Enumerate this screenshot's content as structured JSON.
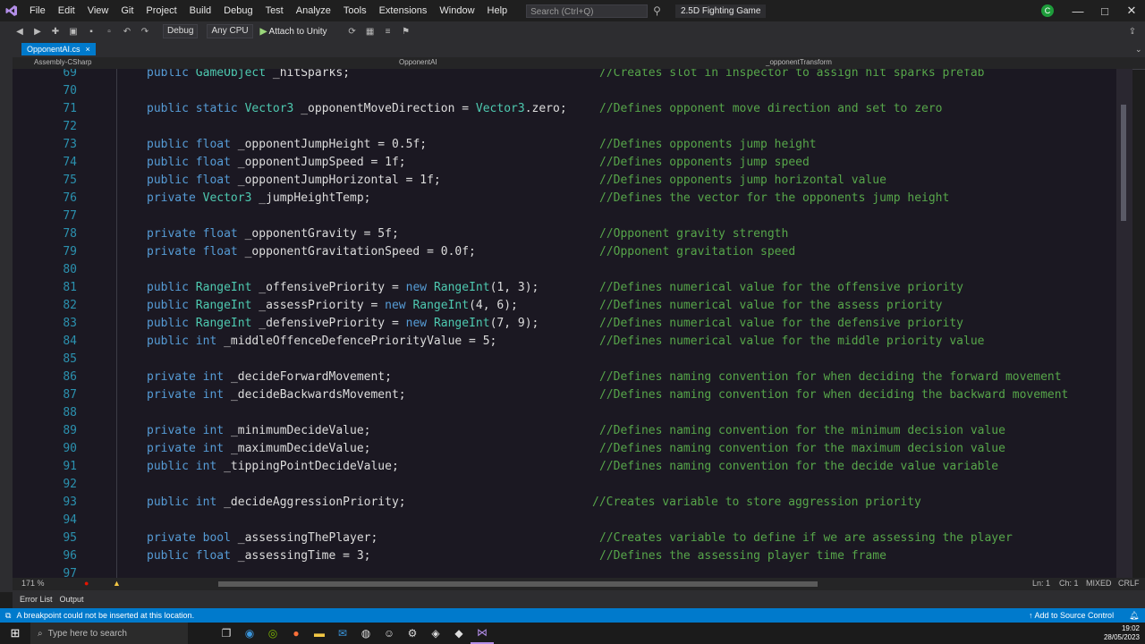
{
  "menubar": {
    "items": [
      "File",
      "Edit",
      "View",
      "Git",
      "Project",
      "Build",
      "Debug",
      "Test",
      "Analyze",
      "Tools",
      "Extensions",
      "Window",
      "Help"
    ],
    "search_placeholder": "Search (Ctrl+Q)",
    "solution_name": "2.5D Fighting Game",
    "avatar_initial": "C"
  },
  "toolbar": {
    "configuration": "Debug",
    "platform": "Any CPU",
    "run_label": "Attach to Unity"
  },
  "document_tab": {
    "filename": "OpponentAI.cs",
    "close": "×"
  },
  "navigation_bar": {
    "project": "Assembly-CSharp",
    "class": "OpponentAI",
    "member": "_opponentTransform"
  },
  "code_lines": [
    {
      "num": "69",
      "code": "public GameObject _hitSparks;",
      "comment": "//Creates slot in inspector to assign hit sparks prefab"
    },
    {
      "num": "70",
      "code": "",
      "comment": ""
    },
    {
      "num": "71",
      "code": "public static Vector3 _opponentMoveDirection = Vector3.zero;",
      "comment": "//Defines opponent move direction and set to zero"
    },
    {
      "num": "72",
      "code": "",
      "comment": ""
    },
    {
      "num": "73",
      "code": "public float _opponentJumpHeight = 0.5f;",
      "comment": "//Defines opponents jump height"
    },
    {
      "num": "74",
      "code": "public float _opponentJumpSpeed = 1f;",
      "comment": "//Defines opponents jump speed"
    },
    {
      "num": "75",
      "code": "public float _opponentJumpHorizontal = 1f;",
      "comment": "//Defines opponents jump horizontal value"
    },
    {
      "num": "76",
      "code": "private Vector3 _jumpHeightTemp;",
      "comment": "//Defines the vector for the opponents jump height"
    },
    {
      "num": "77",
      "code": "",
      "comment": ""
    },
    {
      "num": "78",
      "code": "private float _opponentGravity = 5f;",
      "comment": "//Opponent gravity strength"
    },
    {
      "num": "79",
      "code": "private float _opponentGravitationSpeed = 0.0f;",
      "comment": "//Opponent gravitation speed"
    },
    {
      "num": "80",
      "code": "",
      "comment": ""
    },
    {
      "num": "81",
      "code": "public RangeInt _offensivePriority = new RangeInt(1, 3);",
      "comment": "//Defines numerical value for the offensive priority"
    },
    {
      "num": "82",
      "code": "public RangeInt _assessPriority = new RangeInt(4, 6);",
      "comment": "//Defines numerical value for the assess priority"
    },
    {
      "num": "83",
      "code": "public RangeInt _defensivePriority = new RangeInt(7, 9);",
      "comment": "//Defines numerical value for the defensive priority"
    },
    {
      "num": "84",
      "code": "public int _middleOffenceDefencePriorityValue = 5;",
      "comment": "//Defines numerical value for the middle priority value"
    },
    {
      "num": "85",
      "code": "",
      "comment": ""
    },
    {
      "num": "86",
      "code": "private int _decideForwardMovement;",
      "comment": "//Defines naming convention for when deciding the forward movement"
    },
    {
      "num": "87",
      "code": "private int _decideBackwardsMovement;",
      "comment": "//Defines naming convention for when deciding the backward movement"
    },
    {
      "num": "88",
      "code": "",
      "comment": ""
    },
    {
      "num": "89",
      "code": "private int _minimumDecideValue;",
      "comment": "//Defines naming convention for the minimum decision value"
    },
    {
      "num": "90",
      "code": "private int _maximumDecideValue;",
      "comment": "//Defines naming convention for the maximum decision value"
    },
    {
      "num": "91",
      "code": "public int _tippingPointDecideValue;",
      "comment": "//Defines naming convention for the decide value variable"
    },
    {
      "num": "92",
      "code": "",
      "comment": ""
    },
    {
      "num": "93",
      "code": "public int _decideAggressionPriority;",
      "comment": "//Creates variable to store aggression priority"
    },
    {
      "num": "94",
      "code": "",
      "comment": ""
    },
    {
      "num": "95",
      "code": "private bool _assessingThePlayer;",
      "comment": "//Creates variable to define if we are assessing the player"
    },
    {
      "num": "96",
      "code": "public float _assessingTime = 3;",
      "comment": "//Defines the assessing player time frame"
    },
    {
      "num": "97",
      "code": "",
      "comment": ""
    }
  ],
  "editor_status": {
    "zoom": "171 %",
    "line": "Ln: 1",
    "col": "Ch: 1",
    "mode": "MIXED",
    "eol": "CRLF"
  },
  "bottom_tabs": [
    "Error List",
    "Output"
  ],
  "statusbar": {
    "message": "A breakpoint could not be inserted at this location.",
    "source_control": "Add to Source Control"
  },
  "taskbar": {
    "search_placeholder": "Type here to search",
    "time": "19:02",
    "date": "28/05/2023"
  }
}
